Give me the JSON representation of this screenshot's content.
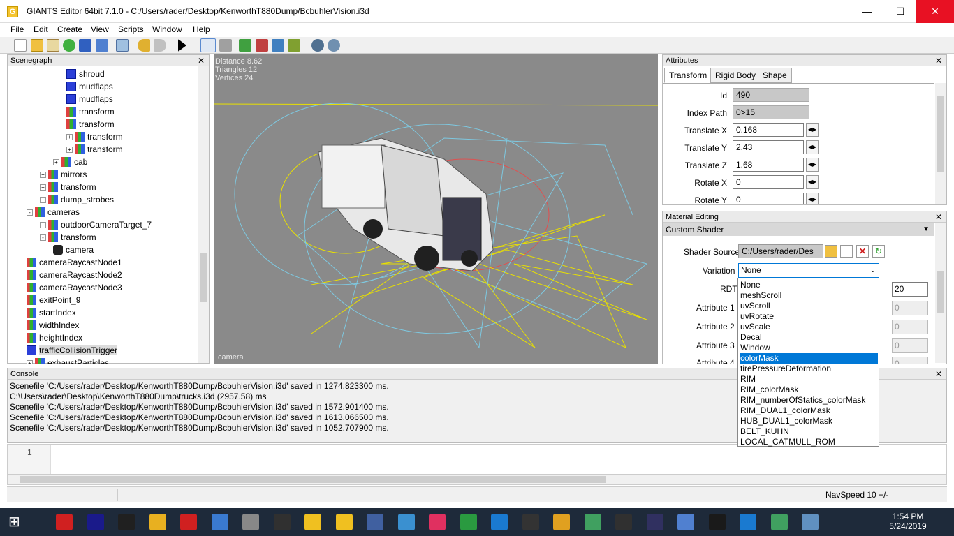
{
  "window": {
    "title": "GIANTS Editor 64bit 7.1.0 - C:/Users/rader/Desktop/KenworthT880Dump/BcbuhlerVision.i3d",
    "app_icon": "G",
    "minimize": "—",
    "maximize": "☐",
    "close": "✕"
  },
  "menu": [
    "File",
    "Edit",
    "Create",
    "View",
    "Scripts",
    "Window",
    "Help"
  ],
  "scenegraph": {
    "title": "Scenegraph",
    "close": "✕",
    "items": [
      {
        "label": "shroud",
        "icon": "cube",
        "indent": 4
      },
      {
        "label": "mudflaps",
        "icon": "cube",
        "indent": 4
      },
      {
        "label": "mudflaps",
        "icon": "cube",
        "indent": 4
      },
      {
        "label": "transform",
        "icon": "tf",
        "indent": 4
      },
      {
        "label": "transform",
        "icon": "tf",
        "indent": 4
      },
      {
        "label": "transform",
        "icon": "tf",
        "indent": 4,
        "expand": "+"
      },
      {
        "label": "transform",
        "icon": "tf",
        "indent": 4,
        "expand": "+"
      },
      {
        "label": "cab",
        "icon": "tf",
        "indent": 3,
        "expand": "+"
      },
      {
        "label": "mirrors",
        "icon": "tf",
        "indent": 2,
        "expand": "+"
      },
      {
        "label": "transform",
        "icon": "tf",
        "indent": 2,
        "expand": "+"
      },
      {
        "label": "dump_strobes",
        "icon": "tf",
        "indent": 2,
        "expand": "+"
      },
      {
        "label": "cameras",
        "icon": "tf",
        "indent": 1,
        "expand": "-"
      },
      {
        "label": "outdoorCameraTarget_7",
        "icon": "tf",
        "indent": 2,
        "expand": "+"
      },
      {
        "label": "transform",
        "icon": "tf",
        "indent": 2,
        "expand": "-"
      },
      {
        "label": "camera",
        "icon": "cam",
        "indent": 3
      },
      {
        "label": "cameraRaycastNode1",
        "icon": "tf",
        "indent": 1
      },
      {
        "label": "cameraRaycastNode2",
        "icon": "tf",
        "indent": 1
      },
      {
        "label": "cameraRaycastNode3",
        "icon": "tf",
        "indent": 1
      },
      {
        "label": "exitPoint_9",
        "icon": "tf",
        "indent": 1
      },
      {
        "label": "startIndex",
        "icon": "tf",
        "indent": 1
      },
      {
        "label": "widthIndex",
        "icon": "tf",
        "indent": 1
      },
      {
        "label": "heightIndex",
        "icon": "tf",
        "indent": 1
      },
      {
        "label": "trafficCollisionTrigger",
        "icon": "cube",
        "indent": 1,
        "selected": true
      },
      {
        "label": "exhaustParticles",
        "icon": "tf",
        "indent": 1,
        "expand": "+"
      }
    ]
  },
  "viewport": {
    "distance": "Distance 8.62",
    "triangles": "Triangles 12",
    "vertices": "Vertices 24",
    "camera_label": "camera"
  },
  "attributes": {
    "title": "Attributes",
    "close": "✕",
    "tabs": [
      "Transform",
      "Rigid Body",
      "Shape"
    ],
    "fields": [
      {
        "label": "Id",
        "value": "490",
        "readonly": true
      },
      {
        "label": "Index Path",
        "value": "0>15",
        "readonly": true
      },
      {
        "label": "Translate X",
        "value": "0.168"
      },
      {
        "label": "Translate Y",
        "value": "2.43"
      },
      {
        "label": "Translate Z",
        "value": "1.68"
      },
      {
        "label": "Rotate X",
        "value": "0"
      },
      {
        "label": "Rotate Y",
        "value": "0"
      }
    ]
  },
  "material": {
    "title": "Material Editing",
    "close": "✕",
    "section": "Custom Shader",
    "shader_source_label": "Shader Source",
    "shader_source_value": "C:/Users/rader/Des",
    "variation_label": "Variation",
    "variation_value": "None",
    "rows": [
      {
        "label": "RDT",
        "value": "20"
      },
      {
        "label": "Attribute 1",
        "value": "0"
      },
      {
        "label": "Attribute 2",
        "value": "0"
      },
      {
        "label": "Attribute 3",
        "value": "0"
      },
      {
        "label": "Attribute 4",
        "value": "0"
      }
    ]
  },
  "dropdown": {
    "options": [
      "None",
      "meshScroll",
      "uvScroll",
      "uvRotate",
      "uvScale",
      "Decal",
      "Window",
      "colorMask",
      "tirePressureDeformation",
      "RIM",
      "RIM_colorMask",
      "RIM_numberOfStatics_colorMask",
      "RIM_DUAL1_colorMask",
      "HUB_DUAL1_colorMask",
      "BELT_KUHN",
      "LOCAL_CATMULL_ROM"
    ],
    "selected": "colorMask"
  },
  "console": {
    "title": "Console",
    "close": "✕",
    "lines": [
      "Scenefile 'C:/Users/rader/Desktop/KenworthT880Dump/BcbuhlerVision.i3d' saved in 1274.823300 ms.",
      "C:\\Users\\rader\\Desktop\\KenworthT880Dump\\trucks.i3d (2957.58) ms",
      "Scenefile 'C:/Users/rader/Desktop/KenworthT880Dump/BcbuhlerVision.i3d' saved in 1572.901400 ms.",
      "Scenefile 'C:/Users/rader/Desktop/KenworthT880Dump/BcbuhlerVision.i3d' saved in 1613.066500 ms.",
      "Scenefile 'C:/Users/rader/Desktop/KenworthT880Dump/BcbuhlerVision.i3d' saved in 1052.707900 ms."
    ]
  },
  "editor": {
    "line_number": "1"
  },
  "status": {
    "navspeed": "NavSpeed 10 +/-"
  },
  "taskbar": {
    "time": "1:54 PM",
    "date": "5/24/2019",
    "colors": [
      "#d02020",
      "#1a1a8a",
      "#202020",
      "#e8b020",
      "#d02020",
      "#3a7ad0",
      "#888888",
      "#303030",
      "#f0c020",
      "#f0c020",
      "#4060a0",
      "#3a90d0",
      "#e03060",
      "#2a9a40",
      "#1a7ad0",
      "#333333",
      "#e0a020",
      "#40a060",
      "#303030",
      "#303060",
      "#5080d0",
      "#1a1a1a",
      "#1a7ad0",
      "#40a060",
      "#6090c0"
    ]
  }
}
